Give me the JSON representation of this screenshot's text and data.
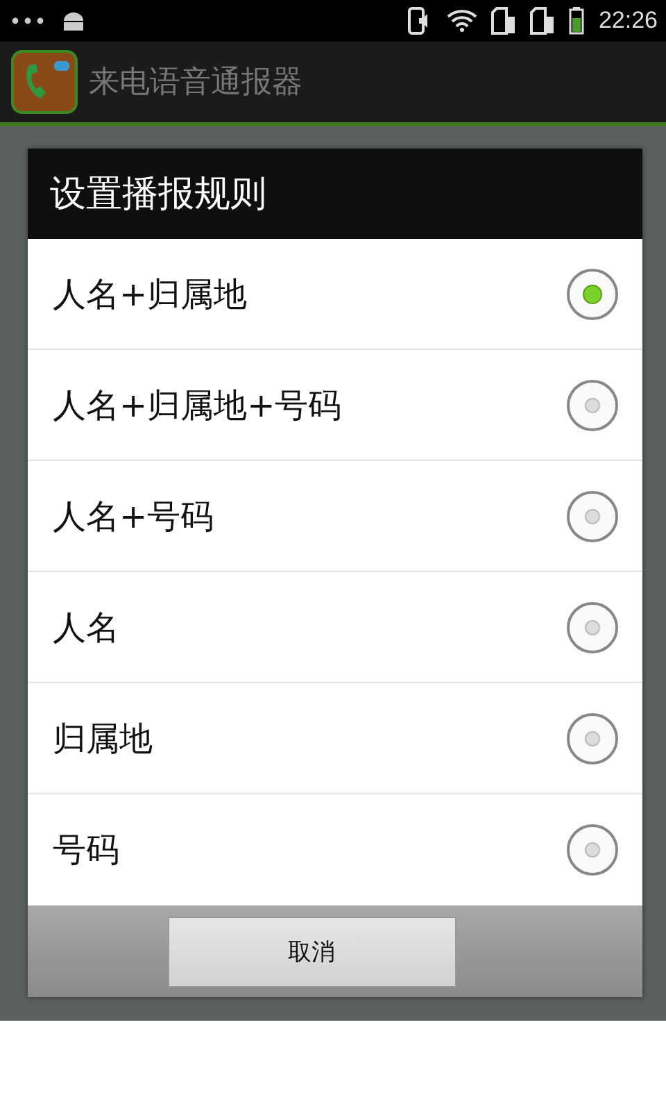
{
  "status_bar": {
    "time": "22:26"
  },
  "app_bar": {
    "title": "来电语音通报器"
  },
  "dialog": {
    "title": "设置播报规则",
    "options": [
      {
        "label": "人名+归属地",
        "selected": true
      },
      {
        "label": "人名+归属地+号码",
        "selected": false
      },
      {
        "label": "人名+号码",
        "selected": false
      },
      {
        "label": "人名",
        "selected": false
      },
      {
        "label": "归属地",
        "selected": false
      },
      {
        "label": "号码",
        "selected": false
      }
    ],
    "buttons": [
      "取消"
    ]
  }
}
